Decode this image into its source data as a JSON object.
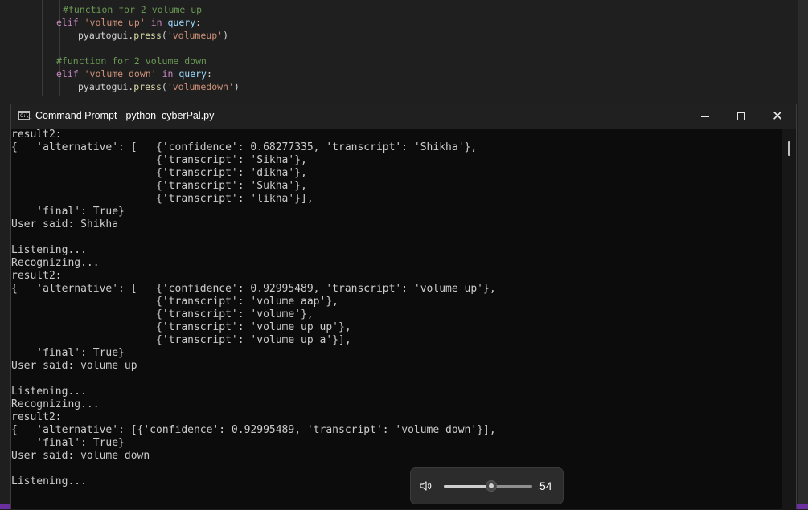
{
  "editor": {
    "lines": [
      {
        "indent": 78,
        "parts": [
          {
            "cls": "c-comment",
            "text": "#function for 2 volume up"
          }
        ]
      },
      {
        "indent": 70,
        "parts": [
          {
            "cls": "c-kw",
            "text": "elif "
          },
          {
            "cls": "c-str",
            "text": "'volume up'"
          },
          {
            "cls": "c-kw",
            "text": " in "
          },
          {
            "cls": "c-var",
            "text": "query"
          },
          {
            "cls": "c-punc",
            "text": ":"
          }
        ]
      },
      {
        "indent": 97,
        "parts": [
          {
            "cls": "c-def",
            "text": "pyautogui."
          },
          {
            "cls": "c-fn",
            "text": "press"
          },
          {
            "cls": "c-punc",
            "text": "("
          },
          {
            "cls": "c-str",
            "text": "'volumeup'"
          },
          {
            "cls": "c-punc",
            "text": ")"
          }
        ]
      },
      {
        "indent": 0,
        "parts": []
      },
      {
        "indent": 70,
        "parts": [
          {
            "cls": "c-comment",
            "text": "#function for 2 volume down"
          }
        ]
      },
      {
        "indent": 70,
        "parts": [
          {
            "cls": "c-kw",
            "text": "elif "
          },
          {
            "cls": "c-str",
            "text": "'volume down'"
          },
          {
            "cls": "c-kw",
            "text": " in "
          },
          {
            "cls": "c-var",
            "text": "query"
          },
          {
            "cls": "c-punc",
            "text": ":"
          }
        ]
      },
      {
        "indent": 97,
        "parts": [
          {
            "cls": "c-def",
            "text": "pyautogui."
          },
          {
            "cls": "c-fn",
            "text": "press"
          },
          {
            "cls": "c-punc",
            "text": "("
          },
          {
            "cls": "c-str",
            "text": "'volumedown'"
          },
          {
            "cls": "c-punc",
            "text": ")"
          }
        ]
      }
    ]
  },
  "cmd_window": {
    "title": "Command Prompt - python  cyberPal.py",
    "icon": "cmd-app-icon",
    "icon_glyph": "C:\\_",
    "controls": {
      "minimize": "minimize-icon",
      "maximize": "maximize-icon",
      "close": "close-icon"
    },
    "console_lines": [
      "result2:",
      "{   'alternative': [   {'confidence': 0.68277335, 'transcript': 'Shikha'},",
      "                       {'transcript': 'Sikha'},",
      "                       {'transcript': 'dikha'},",
      "                       {'transcript': 'Sukha'},",
      "                       {'transcript': 'likha'}],",
      "    'final': True}",
      "User said: Shikha",
      "",
      "Listening...",
      "Recognizing...",
      "result2:",
      "{   'alternative': [   {'confidence': 0.92995489, 'transcript': 'volume up'},",
      "                       {'transcript': 'volume aap'},",
      "                       {'transcript': 'volume'},",
      "                       {'transcript': 'volume up up'},",
      "                       {'transcript': 'volume up a'}],",
      "    'final': True}",
      "User said: volume up",
      "",
      "Listening...",
      "Recognizing...",
      "result2:",
      "{   'alternative': [{'confidence': 0.92995489, 'transcript': 'volume down'}],",
      "    'final': True}",
      "User said: volume down",
      "",
      "Listening..."
    ]
  },
  "volume_flyout": {
    "icon": "speaker-icon",
    "level": 54,
    "level_label": "54"
  }
}
